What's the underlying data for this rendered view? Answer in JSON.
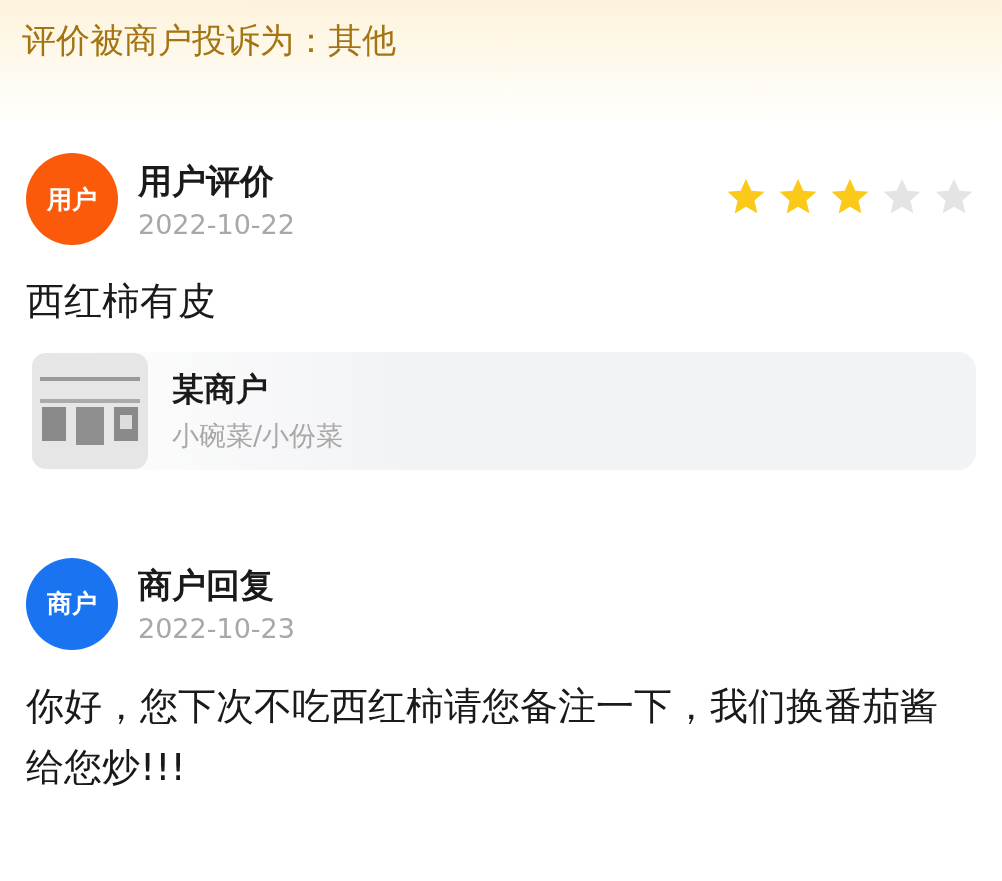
{
  "header": {
    "title": "评价被商户投诉为：其他"
  },
  "posts": [
    {
      "kind": "review",
      "avatar": {
        "label": "用户",
        "color": "#fa5a0a"
      },
      "title": "用户评价",
      "date": "2022-10-22",
      "stars": 3,
      "body": "西红柿有皮",
      "store": {
        "name": "某商户",
        "category": "小碗菜/小份菜"
      }
    },
    {
      "kind": "reply",
      "avatar": {
        "label": "商户",
        "color": "#1a73f0"
      },
      "title": "商户回复",
      "date": "2022-10-23",
      "body": "你好，您下次不吃西红柿请您备注一下，我们换番茄酱给您炒!!!"
    }
  ]
}
